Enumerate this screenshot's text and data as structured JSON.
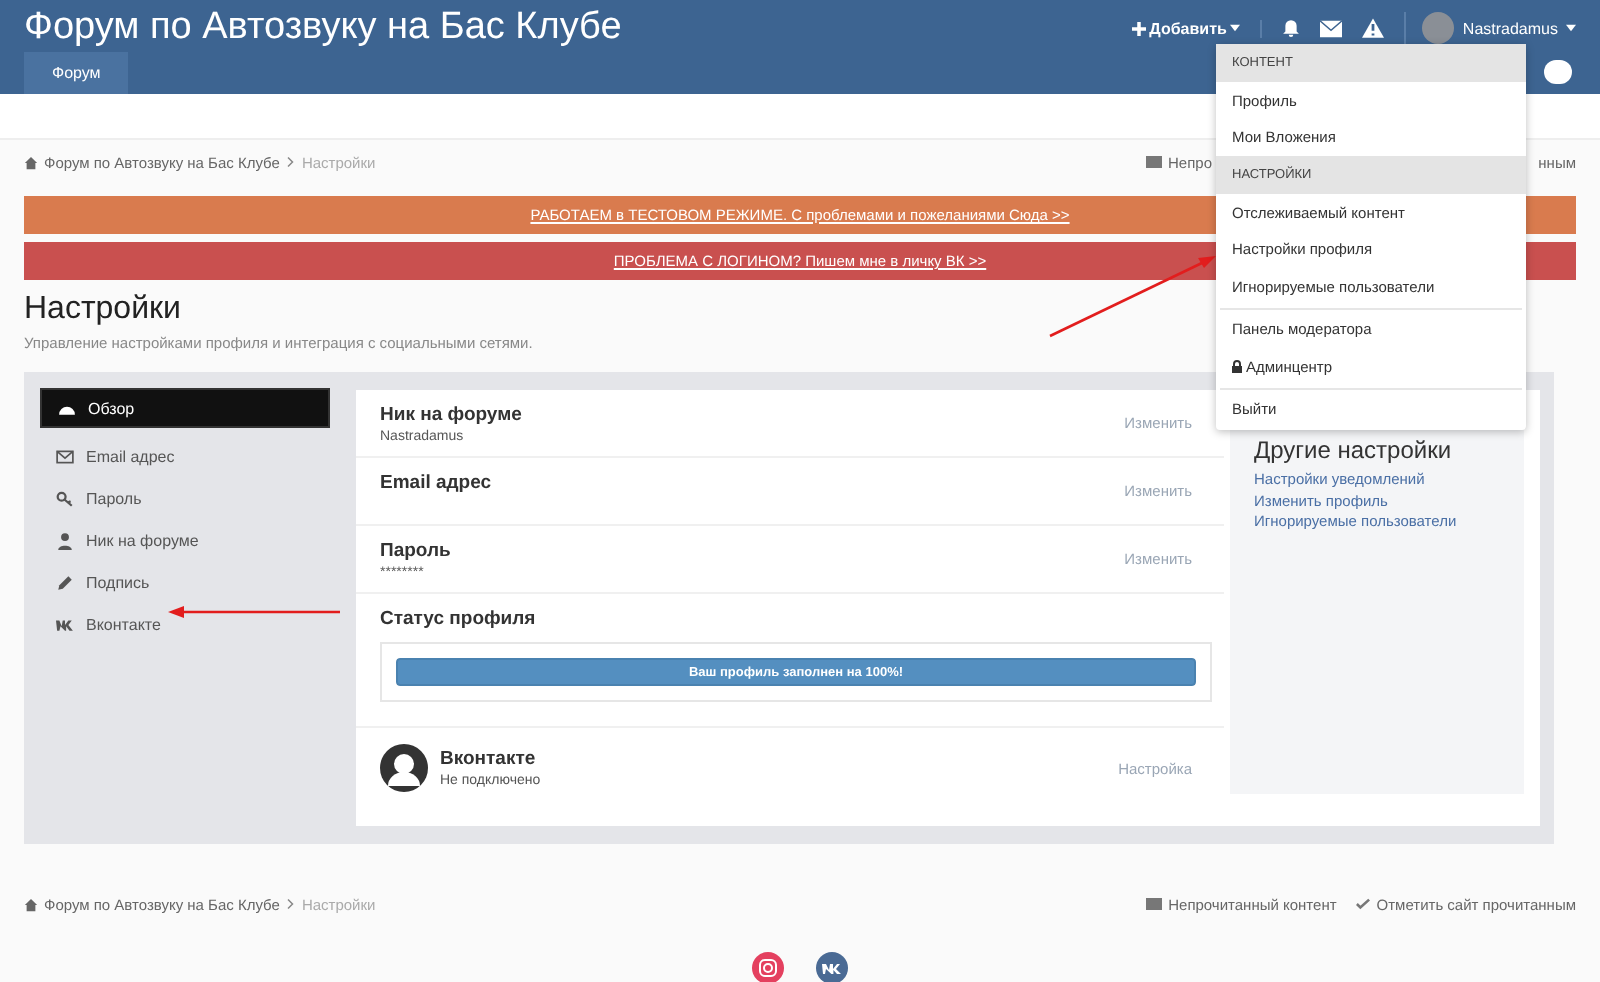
{
  "header": {
    "site_title": "Форум по Автозвуку на Бас Клубе",
    "nav_tabs": [
      {
        "label": "Форум",
        "selected": true
      }
    ],
    "add_label": "Добавить",
    "user_name": "Nastradamus"
  },
  "breadcrumb": {
    "items": [
      "Форум по Автозвуку на Бас Клубе",
      "Настройки"
    ],
    "link_left_fragment": "Непро",
    "link_right_fragment": "нным"
  },
  "notices": [
    {
      "text": "РАБОТАЕМ в ТЕСТОВОМ РЕЖИМЕ. С проблемами и пожеланиями Сюда >>",
      "color": "#d97b4e"
    },
    {
      "text": "ПРОБЛЕМА С ЛОГИНОМ? Пишем мне в личку ВК >>",
      "color": "#c9504f"
    }
  ],
  "page": {
    "title": "Настройки",
    "subtitle": "Управление настройками профиля и интеграция с социальными сетями."
  },
  "sidebar": [
    {
      "label": "Обзор",
      "selected": true
    },
    {
      "label": "Email адрес",
      "selected": false
    },
    {
      "label": "Пароль",
      "selected": false
    },
    {
      "label": "Ник на форуме",
      "selected": false
    },
    {
      "label": "Подпись",
      "selected": false
    },
    {
      "label": "Вконтакте",
      "selected": false
    }
  ],
  "settings": [
    {
      "kind": "field",
      "title": "Ник на форуме",
      "value": "Nastradamus",
      "action": "Изменить"
    },
    {
      "kind": "field",
      "title": "Email адрес",
      "action": "Изменить"
    },
    {
      "kind": "field",
      "title": "Пароль",
      "value": "********",
      "action": "Изменить"
    },
    {
      "kind": "status",
      "title": "Статус профиля",
      "bar_text": "Ваш профиль заполнен на 100%!",
      "level": 1
    },
    {
      "kind": "account",
      "title": "Вконтакте",
      "value": "Не подключено",
      "action": "Настройка"
    }
  ],
  "other_settings": {
    "title": "Другие настройки",
    "links": [
      "Настройки уведомлений",
      "Изменить профиль",
      "Игнорируемые пользователи"
    ]
  },
  "user_menu": [
    {
      "kind": "header",
      "label": "КОНТЕНТ"
    },
    {
      "kind": "item",
      "label": "Профиль"
    },
    {
      "kind": "item",
      "label": "Мои Вложения"
    },
    {
      "kind": "header",
      "label": "НАСТРОЙКИ"
    },
    {
      "kind": "item",
      "label": "Отслеживаемый контент"
    },
    {
      "kind": "item",
      "label": "Настройки профиля"
    },
    {
      "kind": "item",
      "label": "Игнорируемые пользователи"
    },
    {
      "kind": "divider"
    },
    {
      "kind": "item",
      "label": "Панель модератора"
    },
    {
      "kind": "locked",
      "label": "Админцентр"
    },
    {
      "kind": "divider"
    },
    {
      "kind": "item",
      "label": "Выйти"
    }
  ],
  "footer": {
    "breadcrumb": [
      "Форум по Автозвуку на Бас Клубе",
      "Настройки"
    ],
    "links": [
      "Непрочитанный контент",
      "Отметить сайт прочитанным"
    ]
  }
}
